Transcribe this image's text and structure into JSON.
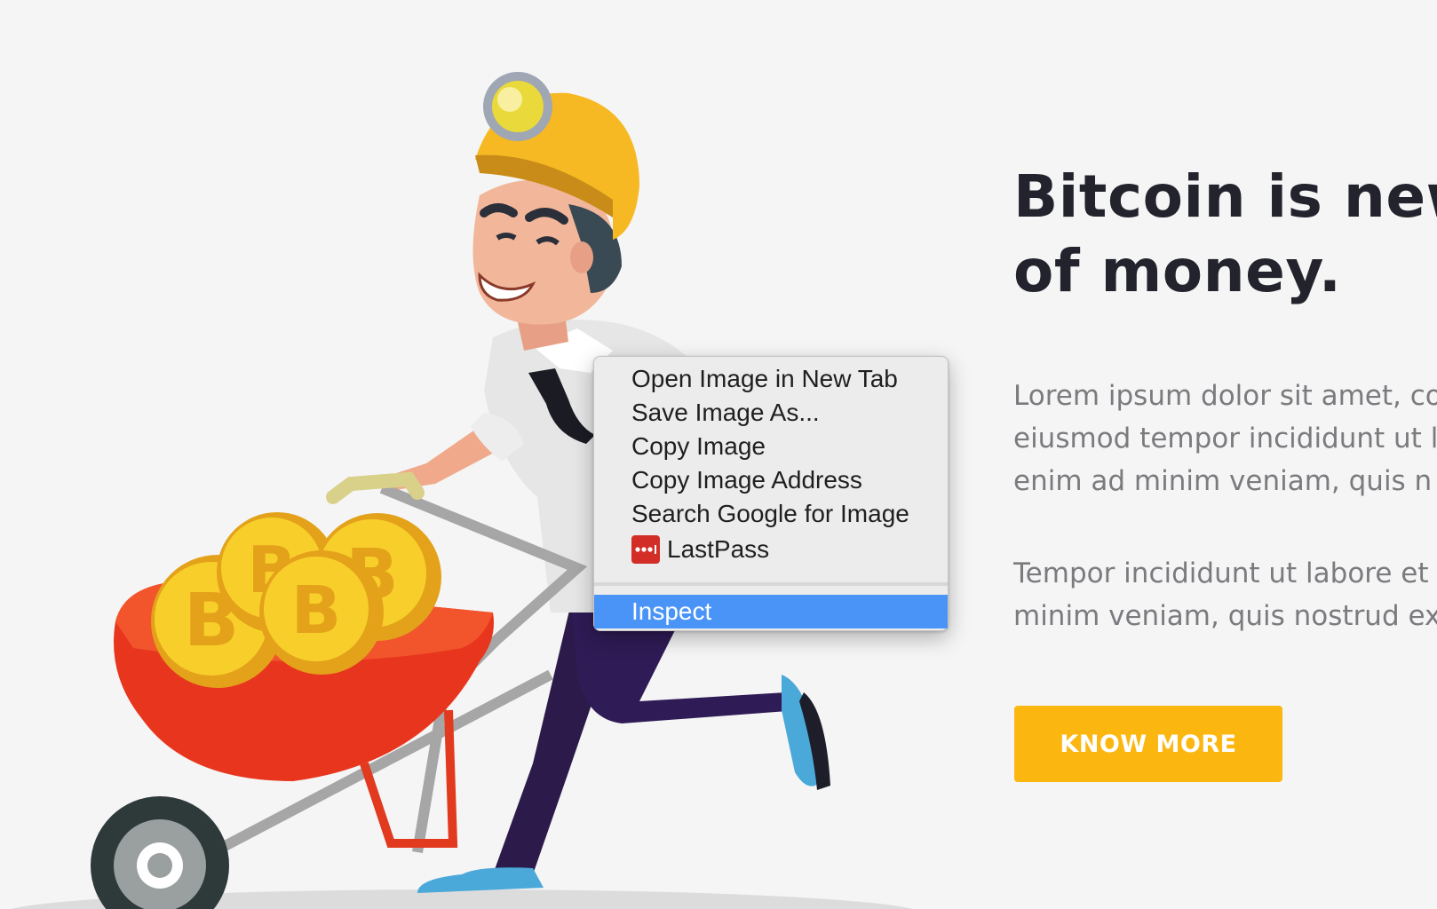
{
  "hero": {
    "title_line1": "Bitcoin is new",
    "title_line2": "of money.",
    "para1_line1": "Lorem ipsum dolor sit amet, co",
    "para1_line2": "eiusmod tempor incididunt ut l",
    "para1_line3": "enim ad minim veniam, quis n",
    "para2_line1": "Tempor incididunt ut labore et",
    "para2_line2": "minim veniam, quis nostrud ex",
    "button_label": "KNOW MORE",
    "button_color": "#fbb710"
  },
  "context_menu": {
    "items": [
      {
        "label": "Open Image in New Tab"
      },
      {
        "label": "Save Image As..."
      },
      {
        "label": "Copy Image"
      },
      {
        "label": "Copy Image Address"
      },
      {
        "label": "Search Google for Image"
      },
      {
        "label": "LastPass",
        "icon": "lastpass-icon"
      }
    ],
    "inspect_label": "Inspect",
    "highlight_color": "#4a94f7"
  },
  "illustration": {
    "description_icon": "bitcoin-miner-with-wheelbarrow-illustration",
    "coin_symbol": "B"
  }
}
